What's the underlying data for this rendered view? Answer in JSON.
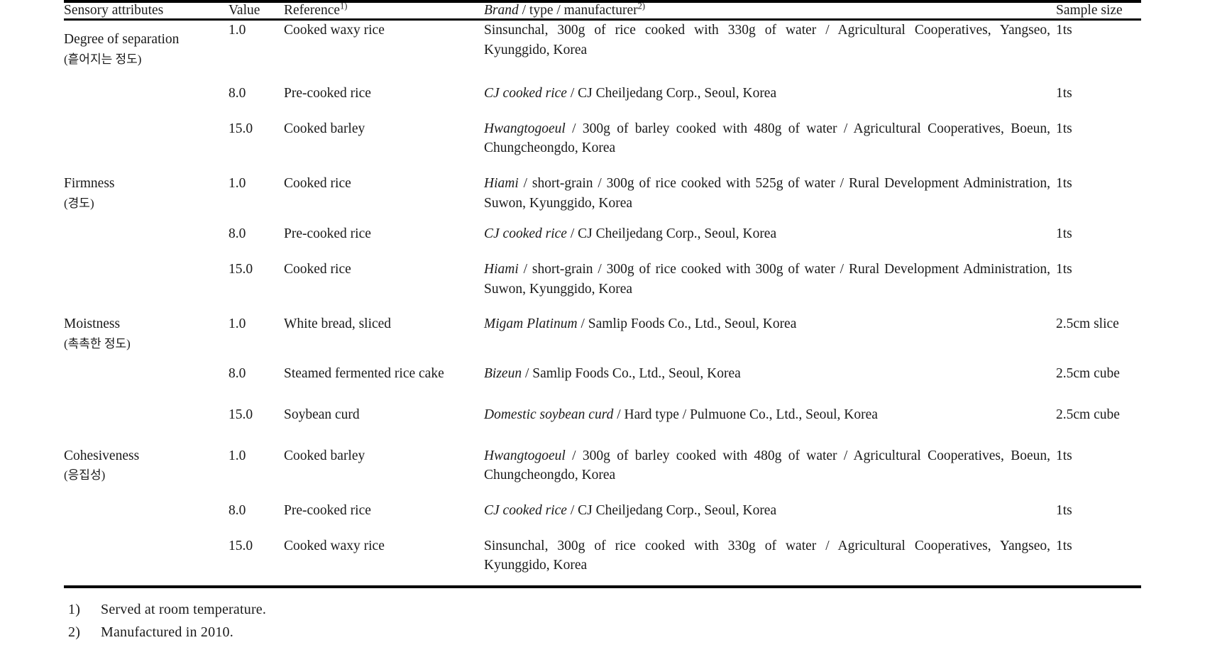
{
  "table": {
    "columns": [
      {
        "key": "attribute",
        "label": "Sensory attributes"
      },
      {
        "key": "value",
        "label": "Value"
      },
      {
        "key": "reference",
        "label": "Reference",
        "superscript": "1)"
      },
      {
        "key": "brand",
        "label_italic": "Brand",
        "label_rest": " /   type / manufacturer",
        "superscript": "2)"
      },
      {
        "key": "sample",
        "label": "Sample size"
      }
    ],
    "sections": [
      {
        "attribute_en": "Degree of separation",
        "attribute_ko": "(흩어지는 정도)",
        "rows": [
          {
            "value": "1.0",
            "reference": "Cooked waxy rice",
            "brand_italic": "",
            "brand_rest": "Sinsunchal,       300g of rice cooked with 330g of water / Agricultural Cooperatives, Yangseo, Kyunggido, Korea",
            "sample": "1ts"
          },
          {
            "value": "8.0",
            "reference": "Pre-cooked rice",
            "brand_italic": "CJ cooked rice",
            "brand_rest": " /   CJ Cheiljedang Corp., Seoul, Korea",
            "sample": "1ts"
          },
          {
            "value": "15.0",
            "reference": "Cooked barley",
            "brand_italic": "Hwangtogoeul",
            "brand_rest": " / 300g    of barley cooked with 480g of water / Agricultural Cooperatives, Boeun, Chungcheongdo,    Korea",
            "sample": "1ts"
          }
        ]
      },
      {
        "attribute_en": "Firmness",
        "attribute_ko": "(경도)",
        "rows": [
          {
            "value": "1.0",
            "reference": "Cooked rice",
            "brand_italic": "Hiami",
            "brand_rest": " /     short-grain / 300g of rice cooked with 525g of water / Rural Development Administration, Suwon, Kyunggido, Korea",
            "sample": "1ts"
          },
          {
            "value": "8.0",
            "reference": "Pre-cooked rice",
            "brand_italic": "CJ cooked rice",
            "brand_rest": " /   CJ Cheiljedang Corp., Seoul, Korea",
            "sample": "1ts"
          },
          {
            "value": "15.0",
            "reference": "Cooked rice",
            "brand_italic": "Hiami",
            "brand_rest": " /     short-grain / 300g of rice cooked with 300g of water / Rural Development Administration, Suwon, Kyunggido, Korea",
            "sample": "1ts"
          }
        ]
      },
      {
        "attribute_en": "Moistness",
        "attribute_ko": "(촉촉한 정도)",
        "rows": [
          {
            "value": "1.0",
            "reference": "White bread, sliced",
            "brand_italic": "Migam Platinum",
            "brand_rest": " /   Samlip Foods Co., Ltd., Seoul, Korea",
            "sample": "2.5cm slice"
          },
          {
            "value": "8.0",
            "reference": "Steamed fermented rice cake",
            "brand_italic": "Bizeun",
            "brand_rest": " /   Samlip Foods Co., Ltd., Seoul, Korea",
            "sample": "2.5cm cube"
          },
          {
            "value": "15.0",
            "reference": "Soybean curd",
            "brand_italic": "Domestic    soybean curd",
            "brand_rest": " / Hard type / Pulmuone Co., Ltd., Seoul, Korea",
            "sample": "2.5cm cube"
          }
        ]
      },
      {
        "attribute_en": "Cohesiveness",
        "attribute_ko": "(응집성)",
        "rows": [
          {
            "value": "1.0",
            "reference": "Cooked barley",
            "brand_italic": "Hwangtogoeul",
            "brand_rest": " /   300g of barley cooked with 480g of water / Agricultural Cooperatives, Boeun, Chungcheongdo,    Korea",
            "sample": "1ts"
          },
          {
            "value": "8.0",
            "reference": "Pre-cooked rice",
            "brand_italic": "CJ cooked rice",
            "brand_rest": " /   CJ Cheiljedang Corp., Seoul, Korea",
            "sample": "1ts"
          },
          {
            "value": "15.0",
            "reference": "Cooked waxy rice",
            "brand_italic": "",
            "brand_rest": "Sinsunchal,       300g of rice cooked with 330g of water / Agricultural Cooperatives, Yangseo, Kyunggido, Korea",
            "sample": "1ts"
          }
        ]
      }
    ]
  },
  "footnotes": [
    {
      "marker": "1)",
      "text": "Served at room temperature."
    },
    {
      "marker": "2)",
      "text": "Manufactured in 2010."
    }
  ]
}
